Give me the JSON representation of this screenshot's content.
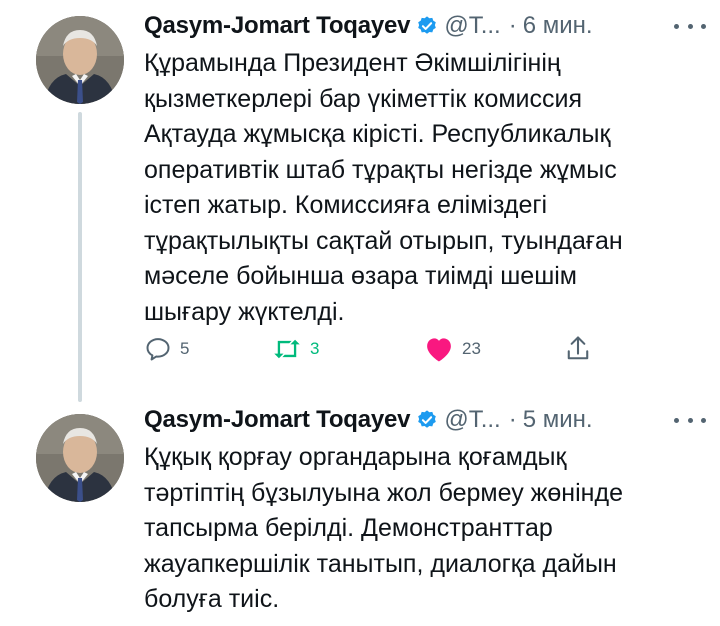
{
  "colors": {
    "accent": "#1d9bf0",
    "retweet_green": "#00ba7c",
    "like_pink": "#f91880",
    "secondary_text": "#536471"
  },
  "tweets": [
    {
      "name": "Qasym-Jomart Toqayev",
      "handle": "@T...",
      "dot": "·",
      "time": "6 мин.",
      "text": "Құрамында Президент Әкімшілігінің\nқызметкерлері бар үкіметтік комиссия\nАқтауда жұмысқа кірісті. Республикалық\nоперативтік штаб тұрақты негізде жұмыс\nістеп жатыр. Комиссияға еліміздегі\nтұрақтылықты сақтай отырып, туындаған\nмәселе бойынша өзара тиімді шешім\nшығару жүктелді.",
      "replies": "5",
      "retweets": "3",
      "likes": "23",
      "liked": true,
      "retweeted": true
    },
    {
      "name": "Qasym-Jomart Toqayev",
      "handle": "@T...",
      "dot": "·",
      "time": "5 мин.",
      "text": "Құқық қорғау органдарына қоғамдық\nтәртіптің бұзылуына жол бермеу жөнінде\nтапсырма берілді. Демонстранттар\nжауапкершілік танытып, диалогқа дайын\nболуға тиіс."
    }
  ]
}
